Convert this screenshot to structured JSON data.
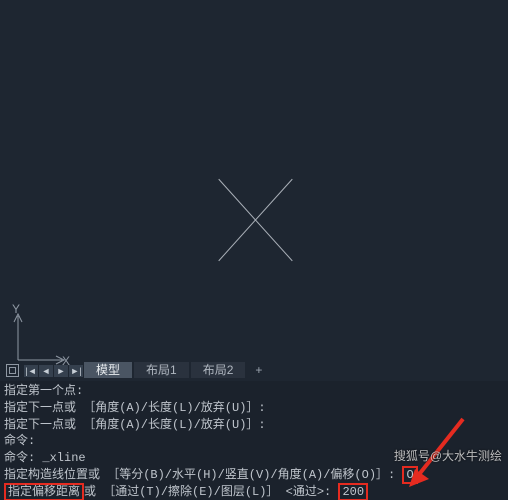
{
  "axes": {
    "x": "X",
    "y": "Y"
  },
  "nav": {
    "first": "|◄",
    "prev": "◄",
    "next": "►",
    "last": "►|"
  },
  "tabs": {
    "model": "模型",
    "layout1": "布局1",
    "layout2": "布局2",
    "add": "+"
  },
  "cmd": {
    "l1": "指定第一个点:",
    "l2": "指定下一点或 ［角度(A)/长度(L)/放弃(U)］:",
    "l3": "指定下一点或 ［角度(A)/长度(L)/放弃(U)］:",
    "l4": "命令:",
    "l5": "命令: _xline",
    "l6a": "指定构造线位置或 ［等分(B)/水平(H)/竖直(V)/角度(A)/偏移(O)］: ",
    "l6b": "O",
    "l7a": "指定偏移距离",
    "l7b": "或 ［通过(T)/擦除(E)/图层(L)］ <通过>: ",
    "l7c": "200"
  },
  "watermark": "搜狐号@大水牛测绘"
}
